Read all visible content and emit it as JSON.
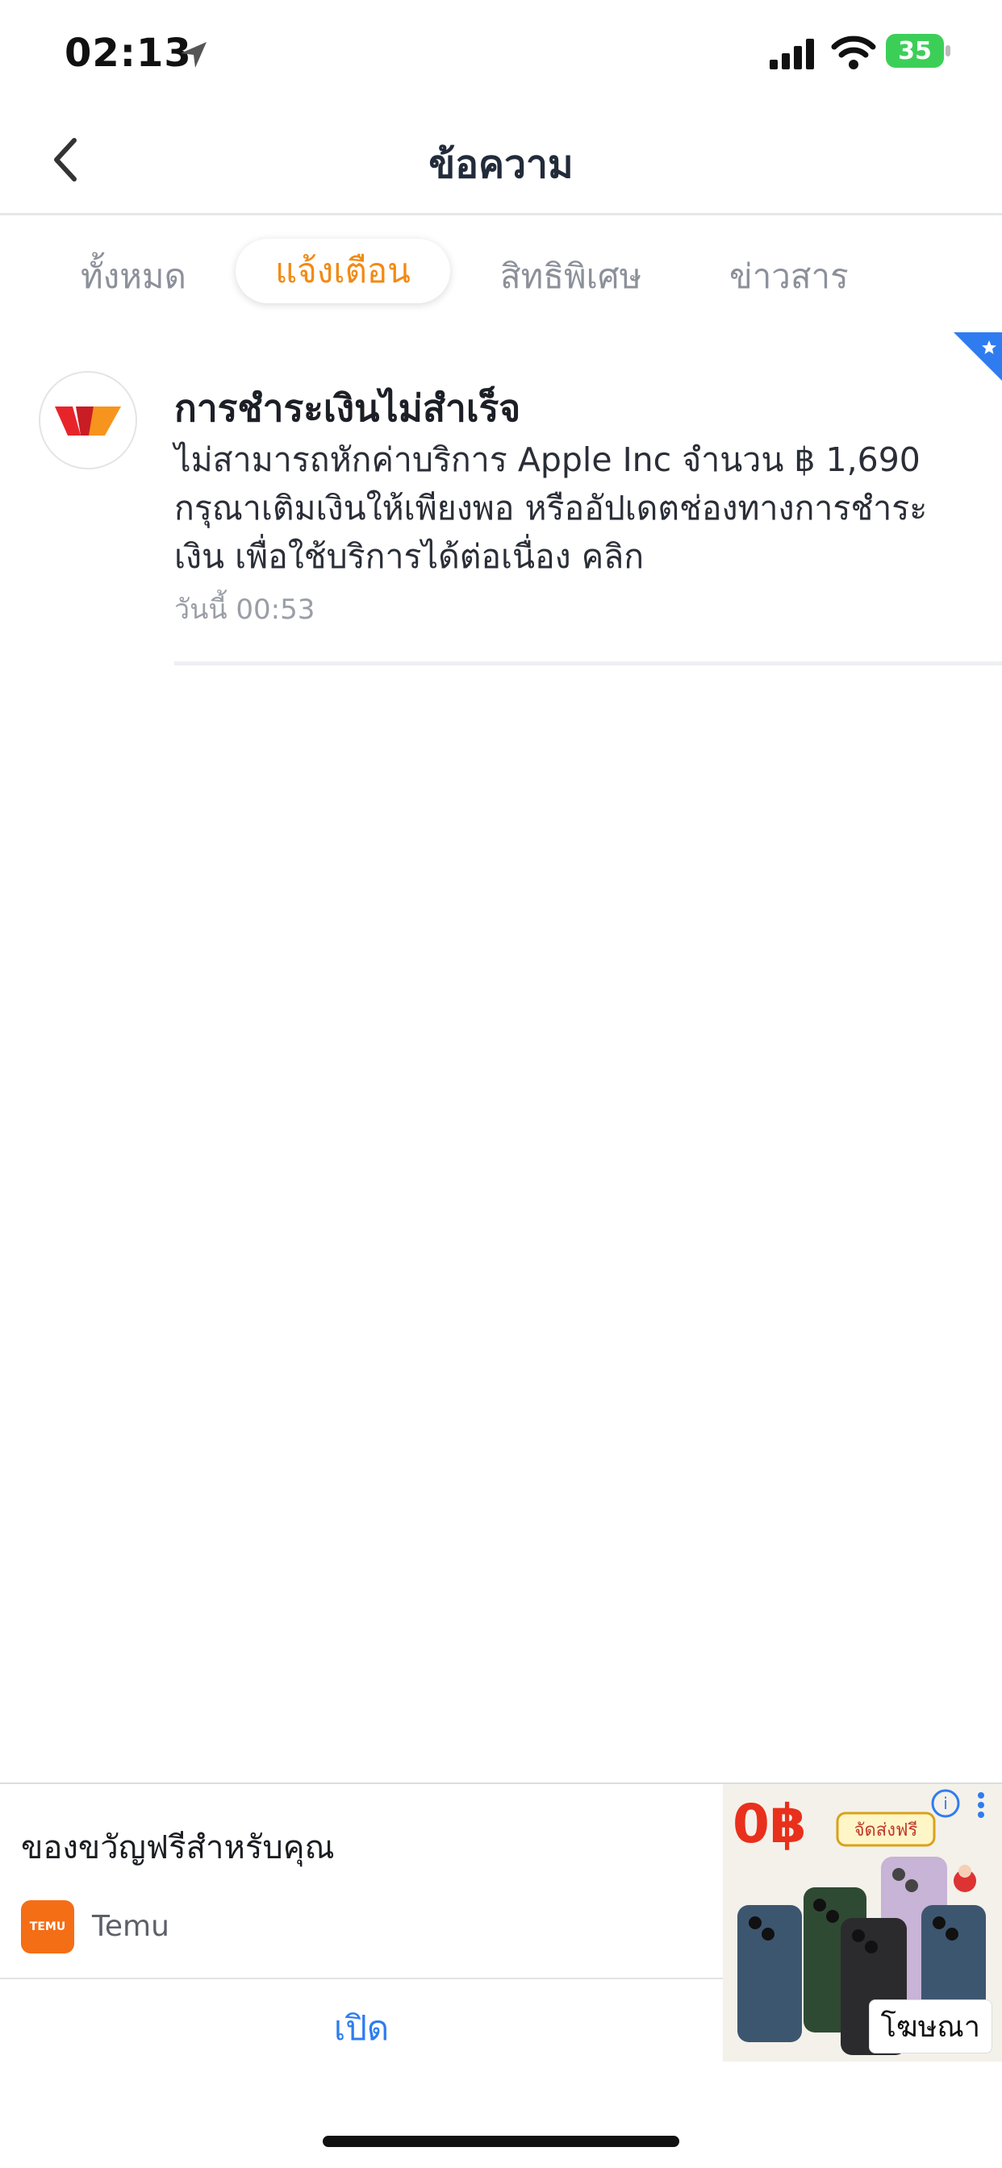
{
  "status_bar": {
    "time": "02:13",
    "battery": "35",
    "icons": [
      "location-arrow-icon",
      "signal-icon",
      "wifi-icon",
      "battery-charging-icon"
    ]
  },
  "header": {
    "title": "ข้อความ",
    "back_icon": "chevron-left-icon"
  },
  "tabs": [
    {
      "label": "ทั้งหมด",
      "active": false
    },
    {
      "label": "แจ้งเตือน",
      "active": true
    },
    {
      "label": "สิทธิพิเศษ",
      "active": false
    },
    {
      "label": "ข่าวสาร",
      "active": false
    }
  ],
  "notification": {
    "title": "การชำระเงินไม่สำเร็จ",
    "body": "ไม่สามารถหักค่าบริการ Apple Inc จำนวน ฿ 1,690 กรุณาเติมเงินให้เพียงพอ หรืออัปเดตช่องทางการชำระเงิน เพื่อใช้บริการได้ต่อเนื่อง คลิก",
    "time": "วันนี้ 00:53",
    "pinned_icon": "star-ribbon-icon"
  },
  "ad": {
    "title": "ของขวัญฟรีสำหรับคุณ",
    "brand": "Temu",
    "logo_text": "TEMU",
    "open_label": "เปิด",
    "label": "โฆษณา",
    "image_price": "0฿",
    "image_badge": "จัดส่งฟรี"
  },
  "colors": {
    "accent": "#f28a14",
    "link": "#2f7cf0",
    "ribbon": "#2f7cf0",
    "battery": "#3ccf58"
  }
}
